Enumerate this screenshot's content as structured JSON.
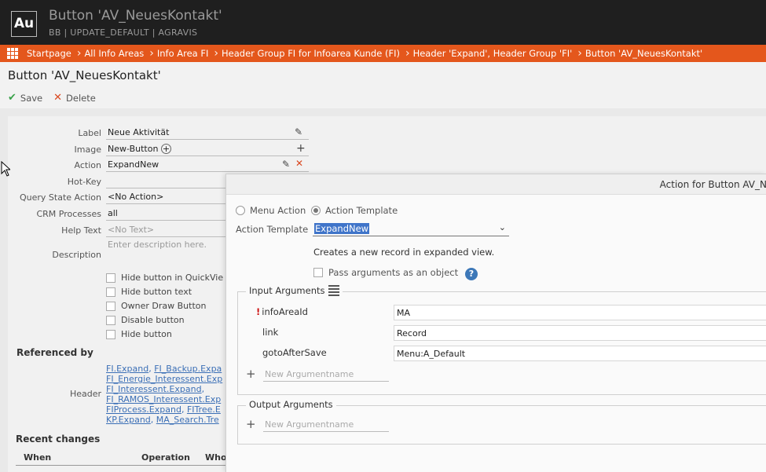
{
  "app": {
    "logo": "Au",
    "title": "Button 'AV_NeuesKontakt'",
    "subtitle": "BB | UPDATE_DEFAULT | AGRAVIS"
  },
  "breadcrumb": [
    "Startpage",
    "All Info Areas",
    "Info Area FI",
    "Header Group FI for Infoarea Kunde (FI)",
    "Header 'Expand', Header Group 'FI'",
    "Button 'AV_NeuesKontakt'"
  ],
  "page": {
    "title": "Button 'AV_NeuesKontakt'",
    "save": "Save",
    "delete": "Delete"
  },
  "form": {
    "label_lbl": "Label",
    "label_val": "Neue Aktivität",
    "image_lbl": "Image",
    "image_val": "New-Button",
    "action_lbl": "Action",
    "action_val": "ExpandNew",
    "hotkey_lbl": "Hot-Key",
    "qsa_lbl": "Query State Action",
    "qsa_val": "<No Action>",
    "crm_lbl": "CRM Processes",
    "crm_val": "all",
    "help_lbl": "Help Text",
    "help_val": "<No Text>",
    "desc_lbl": "Description",
    "desc_ph": "Enter description here.",
    "checks": [
      "Hide button in QuickVie",
      "Hide button text",
      "Owner Draw Button",
      "Disable button",
      "Hide button"
    ]
  },
  "refs": {
    "heading": "Referenced by",
    "header_lbl": "Header",
    "links": [
      "FI.Expand",
      "FI_Backup.Expa",
      "FI_Energie_Interessent.Exp",
      "FI_Interessent.Expand",
      "FI_RAMOS_Interessent.Exp",
      "FIProcess.Expand",
      "FITree.E",
      "KP.Expand",
      "MA_Search.Tre"
    ]
  },
  "recent": {
    "heading": "Recent changes",
    "col_when": "When",
    "col_op": "Operation",
    "col_who": "Who"
  },
  "dialog": {
    "title": "Action for Button AV_N",
    "radio_menu": "Menu Action",
    "radio_template": "Action Template",
    "template_lbl": "Action Template",
    "template_val": "ExpandNew",
    "template_desc": "Creates a new record in expanded view.",
    "pass_args": "Pass arguments as an object",
    "input_legend": "Input Arguments",
    "args": [
      {
        "name": "infoAreaId",
        "value": "MA",
        "required": "!"
      },
      {
        "name": "link",
        "value": "Record",
        "required": ""
      },
      {
        "name": "gotoAfterSave",
        "value": "Menu:A_Default",
        "required": ""
      }
    ],
    "new_arg_ph": "New Argumentname",
    "output_legend": "Output Arguments"
  }
}
